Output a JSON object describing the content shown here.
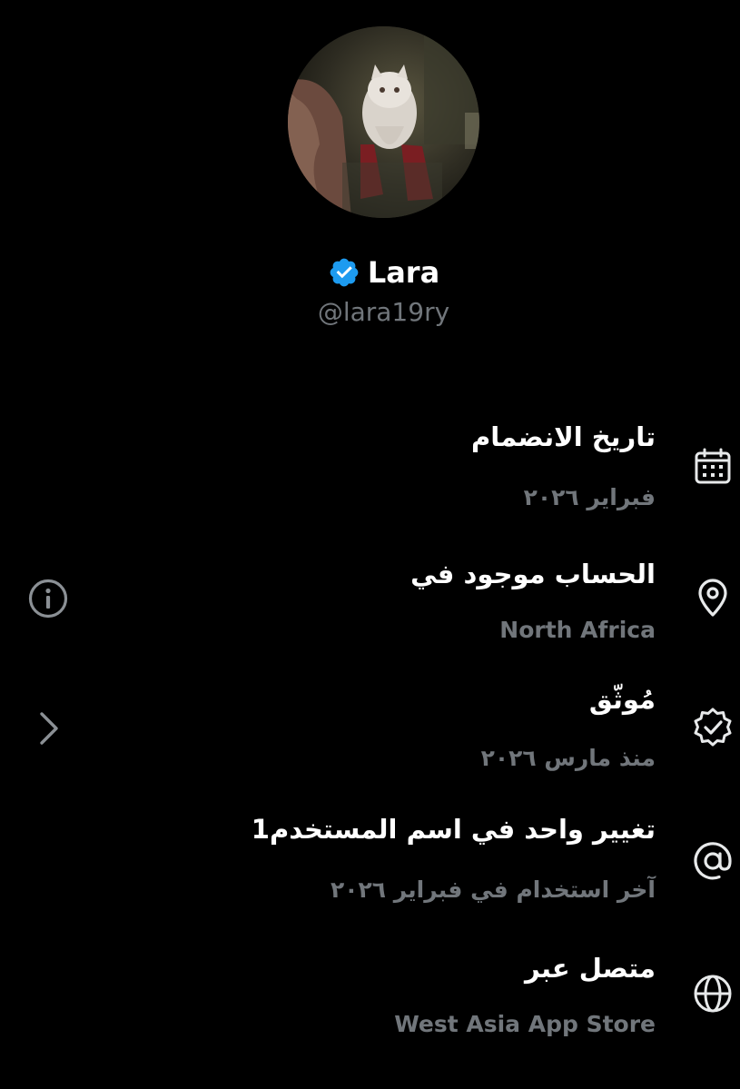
{
  "profile": {
    "display_name": "Lara",
    "handle": "@lara19ry",
    "verified": true,
    "badge_color": "#1d9bf0"
  },
  "details": [
    {
      "icon": "calendar-icon",
      "title": "تاريخ الانضمام",
      "value": "فبراير ٢٠٢٦"
    },
    {
      "icon": "location-pin-icon",
      "title": "الحساب موجود في",
      "value": "North Africa"
    },
    {
      "icon": "verified-badge-outline-icon",
      "title": "مُوثّق",
      "value": "منذ مارس ٢٠٢٦"
    },
    {
      "icon": "at-sign-icon",
      "title": "تغيير واحد في اسم المستخدم1",
      "value": "آخر استخدام في فبراير ٢٠٢٦"
    },
    {
      "icon": "globe-icon",
      "title": "متصل عبر",
      "value": "West Asia App Store"
    }
  ],
  "colors": {
    "background": "#000000",
    "primary_text": "#ffffff",
    "secondary_text": "#71767b",
    "icon": "#e7e9ea"
  }
}
